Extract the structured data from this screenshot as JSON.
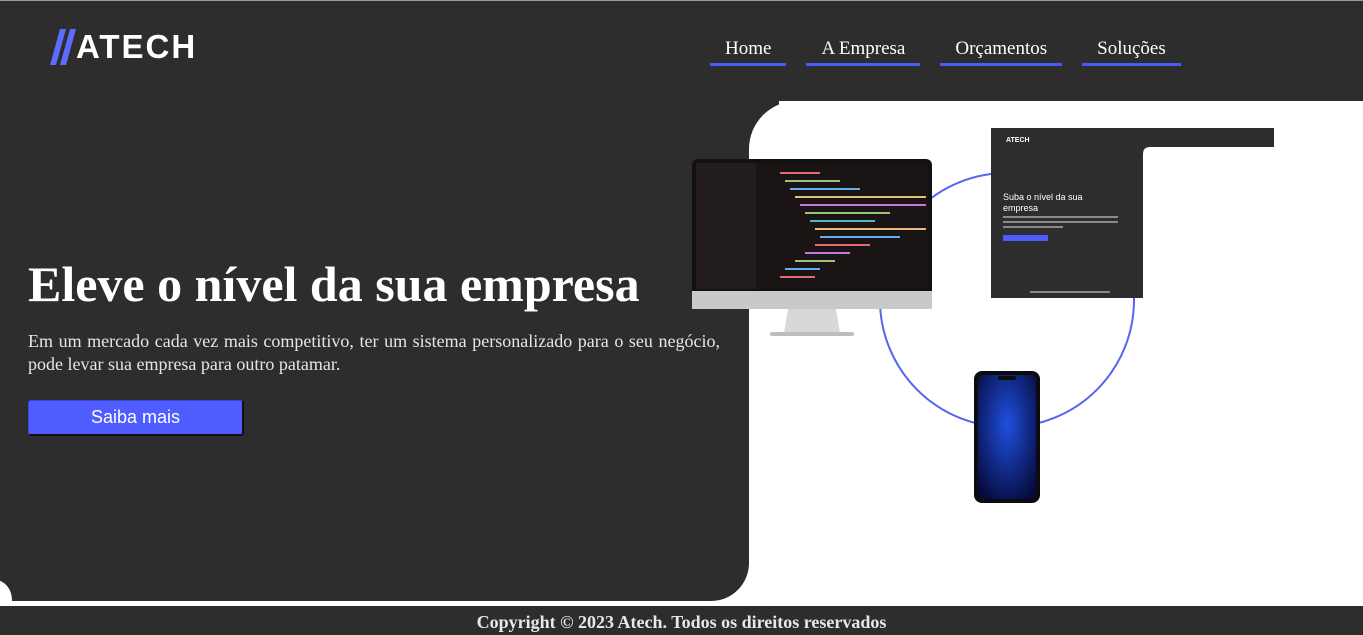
{
  "brand": {
    "logo_text": "ATECH"
  },
  "nav": [
    {
      "label": "Home"
    },
    {
      "label": "A Empresa"
    },
    {
      "label": "Orçamentos"
    },
    {
      "label": "Soluções"
    }
  ],
  "hero": {
    "title": "Eleve o nível da sua empresa",
    "description": "Em um mercado cada vez mais competitivo, ter um sistema personalizado para o seu negócio, pode levar sua empresa para outro patamar.",
    "cta_label": "Saiba mais"
  },
  "illustration": {
    "mini_logo": "ATECH",
    "mini_title": "Suba o nível da sua empresa",
    "mini_footer": "© 2023 Atech · Todos os direitos reservados"
  },
  "footer": {
    "copyright": "Copyright © 2023 Atech. Todos os direitos reservados"
  },
  "colors": {
    "dark": "#2d2d2d",
    "accent": "#4f5cff",
    "white": "#ffffff"
  },
  "icons": {
    "logo_mark": "double-slash-icon"
  }
}
